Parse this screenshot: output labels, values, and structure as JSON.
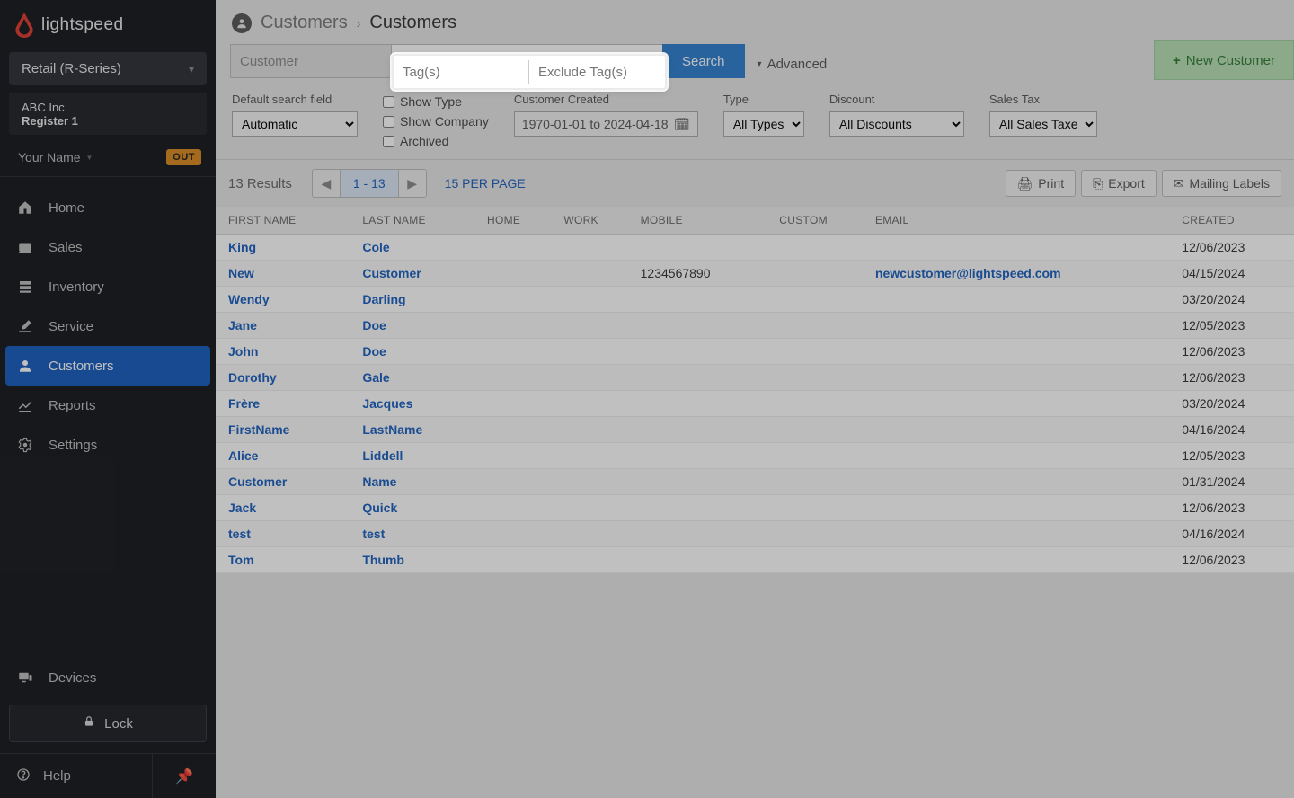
{
  "brand": {
    "name": "lightspeed"
  },
  "product_switcher": {
    "label": "Retail (R-Series)"
  },
  "store": {
    "company": "ABC Inc",
    "register": "Register 1"
  },
  "user": {
    "name": "Your Name",
    "status_badge": "OUT"
  },
  "nav": {
    "items": [
      {
        "label": "Home",
        "icon": "home-icon"
      },
      {
        "label": "Sales",
        "icon": "sales-icon"
      },
      {
        "label": "Inventory",
        "icon": "inventory-icon"
      },
      {
        "label": "Service",
        "icon": "service-icon"
      },
      {
        "label": "Customers",
        "icon": "customers-icon",
        "active": true
      },
      {
        "label": "Reports",
        "icon": "reports-icon"
      },
      {
        "label": "Settings",
        "icon": "settings-icon"
      }
    ],
    "devices": "Devices",
    "lock": "Lock",
    "help": "Help"
  },
  "breadcrumb": {
    "parent": "Customers",
    "current": "Customers"
  },
  "search": {
    "customer_placeholder": "Customer",
    "tags_placeholder": "Tag(s)",
    "exclude_tags_placeholder": "Exclude Tag(s)",
    "button": "Search",
    "advanced": "Advanced",
    "new_customer": "New Customer"
  },
  "filters": {
    "default_field_label": "Default search field",
    "default_field_value": "Automatic",
    "show_type": "Show Type",
    "show_company": "Show Company",
    "archived": "Archived",
    "created_label": "Customer Created",
    "created_range": "1970-01-01 to 2024-04-18",
    "type_label": "Type",
    "type_value": "All Types",
    "discount_label": "Discount",
    "discount_value": "All Discounts",
    "salestax_label": "Sales Tax",
    "salestax_value": "All Sales Taxes"
  },
  "results": {
    "count_text": "13 Results",
    "range": "1 - 13",
    "per_page": "15 PER PAGE"
  },
  "actions": {
    "print": "Print",
    "export": "Export",
    "mailing": "Mailing Labels"
  },
  "columns": {
    "first": "FIRST NAME",
    "last": "LAST NAME",
    "home": "HOME",
    "work": "WORK",
    "mobile": "MOBILE",
    "custom": "CUSTOM",
    "email": "EMAIL",
    "created": "CREATED"
  },
  "rows": [
    {
      "first": "King",
      "last": "Cole",
      "home": "",
      "work": "",
      "mobile": "",
      "custom": "",
      "email": "",
      "created": "12/06/2023"
    },
    {
      "first": "New",
      "last": "Customer",
      "home": "",
      "work": "",
      "mobile": "1234567890",
      "custom": "",
      "email": "newcustomer@lightspeed.com",
      "created": "04/15/2024"
    },
    {
      "first": "Wendy",
      "last": "Darling",
      "home": "",
      "work": "",
      "mobile": "",
      "custom": "",
      "email": "",
      "created": "03/20/2024"
    },
    {
      "first": "Jane",
      "last": "Doe",
      "home": "",
      "work": "",
      "mobile": "",
      "custom": "",
      "email": "",
      "created": "12/05/2023"
    },
    {
      "first": "John",
      "last": "Doe",
      "home": "",
      "work": "",
      "mobile": "",
      "custom": "",
      "email": "",
      "created": "12/06/2023"
    },
    {
      "first": "Dorothy",
      "last": "Gale",
      "home": "",
      "work": "",
      "mobile": "",
      "custom": "",
      "email": "",
      "created": "12/06/2023"
    },
    {
      "first": "Frère",
      "last": "Jacques",
      "home": "",
      "work": "",
      "mobile": "",
      "custom": "",
      "email": "",
      "created": "03/20/2024"
    },
    {
      "first": "FirstName",
      "last": "LastName",
      "home": "",
      "work": "",
      "mobile": "",
      "custom": "",
      "email": "",
      "created": "04/16/2024"
    },
    {
      "first": "Alice",
      "last": "Liddell",
      "home": "",
      "work": "",
      "mobile": "",
      "custom": "",
      "email": "",
      "created": "12/05/2023"
    },
    {
      "first": "Customer",
      "last": "Name",
      "home": "",
      "work": "",
      "mobile": "",
      "custom": "",
      "email": "",
      "created": "01/31/2024"
    },
    {
      "first": "Jack",
      "last": "Quick",
      "home": "",
      "work": "",
      "mobile": "",
      "custom": "",
      "email": "",
      "created": "12/06/2023"
    },
    {
      "first": "test",
      "last": "test",
      "home": "",
      "work": "",
      "mobile": "",
      "custom": "",
      "email": "",
      "created": "04/16/2024"
    },
    {
      "first": "Tom",
      "last": "Thumb",
      "home": "",
      "work": "",
      "mobile": "",
      "custom": "",
      "email": "",
      "created": "12/06/2023"
    }
  ]
}
